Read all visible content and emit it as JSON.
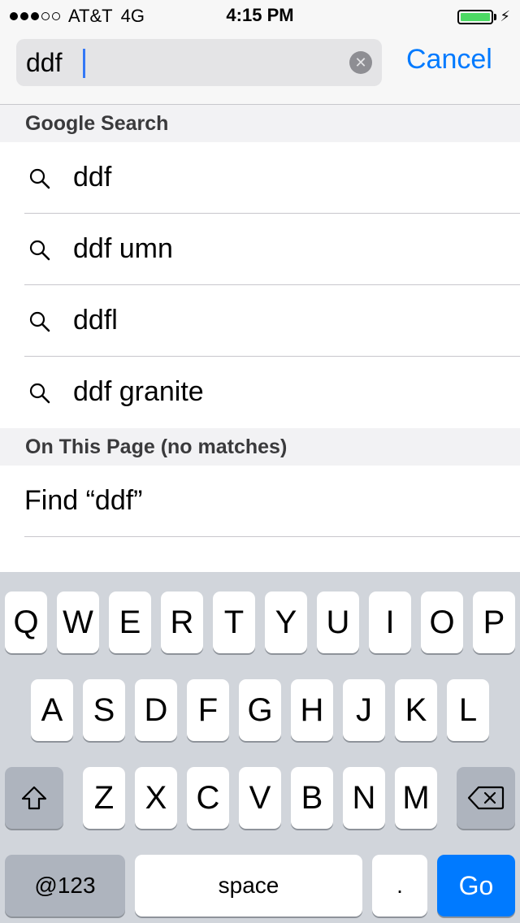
{
  "status_bar": {
    "carrier": "AT&T",
    "network": "4G",
    "time": "4:15 PM",
    "signal_bars_filled": 3,
    "signal_bars_total": 5,
    "battery_level": 1.0,
    "charging_icon": "bolt-icon"
  },
  "search": {
    "value": "ddf",
    "clear_icon": "clear-icon",
    "cancel_label": "Cancel"
  },
  "sections": {
    "google_header": "Google Search",
    "on_page_header": "On This Page (no matches)"
  },
  "suggestions": [
    {
      "text": "ddf",
      "icon": "search-icon"
    },
    {
      "text": "ddf umn",
      "icon": "search-icon"
    },
    {
      "text": "ddfl",
      "icon": "search-icon"
    },
    {
      "text": "ddf granite",
      "icon": "search-icon"
    }
  ],
  "find": {
    "text": "Find “ddf”"
  },
  "keyboard": {
    "row1": [
      "Q",
      "W",
      "E",
      "R",
      "T",
      "Y",
      "U",
      "I",
      "O",
      "P"
    ],
    "row2": [
      "A",
      "S",
      "D",
      "F",
      "G",
      "H",
      "J",
      "K",
      "L"
    ],
    "row3": [
      "Z",
      "X",
      "C",
      "V",
      "B",
      "N",
      "M"
    ],
    "shift_icon": "shift-icon",
    "delete_icon": "delete-icon",
    "numbers_label": "@123",
    "space_label": "space",
    "period_label": ".",
    "go_label": "Go"
  },
  "colors": {
    "accent": "#007aff",
    "battery": "#4cd964",
    "keyboard_bg": "#d1d5db"
  }
}
